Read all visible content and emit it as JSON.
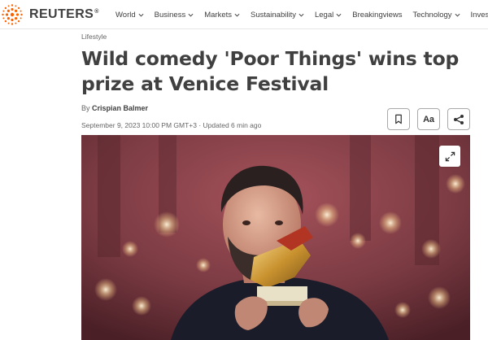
{
  "brand": {
    "name": "REUTERS",
    "reg": "®",
    "color": "#fa6400"
  },
  "nav": {
    "items": [
      {
        "label": "World",
        "has_menu": true
      },
      {
        "label": "Business",
        "has_menu": true
      },
      {
        "label": "Markets",
        "has_menu": true
      },
      {
        "label": "Sustainability",
        "has_menu": true
      },
      {
        "label": "Legal",
        "has_menu": true
      },
      {
        "label": "Breakingviews",
        "has_menu": false
      },
      {
        "label": "Technology",
        "has_menu": true
      },
      {
        "label": "Investig",
        "has_menu": false
      }
    ]
  },
  "article": {
    "section": "Lifestyle",
    "title": "Wild comedy 'Poor Things' wins top prize at Venice Festival",
    "byline_prefix": "By ",
    "author": "Crispian Balmer",
    "dateline": "September 9, 2023 10:00 PM GMT+3 · Updated 6 min ago"
  },
  "actions": {
    "bookmark_icon": "bookmark-icon",
    "text_size_label": "Aa",
    "share_icon": "share-icon"
  },
  "photo": {
    "expand_icon": "expand-icon",
    "bg_color": "#7a3a42"
  }
}
